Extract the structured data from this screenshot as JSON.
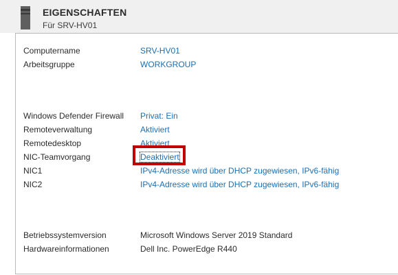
{
  "header": {
    "title": "EIGENSCHAFTEN",
    "subtitle": "Für SRV-HV01"
  },
  "properties": {
    "computername": {
      "label": "Computername",
      "value": "SRV-HV01"
    },
    "arbeitsgruppe": {
      "label": "Arbeitsgruppe",
      "value": "WORKGROUP"
    },
    "firewall": {
      "label": "Windows Defender Firewall",
      "value": "Privat: Ein"
    },
    "remoteverwaltung": {
      "label": "Remoteverwaltung",
      "value": "Aktiviert"
    },
    "remotedesktop": {
      "label": "Remotedesktop",
      "value": "Aktiviert"
    },
    "nic_team": {
      "label": "NIC-Teamvorgang",
      "value": "Deaktiviert"
    },
    "nic1": {
      "label": "NIC1",
      "value": "IPv4-Adresse wird über DHCP zugewiesen, IPv6-fähig"
    },
    "nic2": {
      "label": "NIC2",
      "value": "IPv4-Adresse wird über DHCP zugewiesen, IPv6-fähig"
    },
    "os_version": {
      "label": "Betriebssystemversion",
      "value": "Microsoft Windows Server 2019 Standard"
    },
    "hardware": {
      "label": "Hardwareinformationen",
      "value": "Dell Inc. PowerEdge R440"
    }
  },
  "colors": {
    "link": "#1a6fb5",
    "highlight": "#c00000",
    "header_bg": "#f0f0f0"
  }
}
